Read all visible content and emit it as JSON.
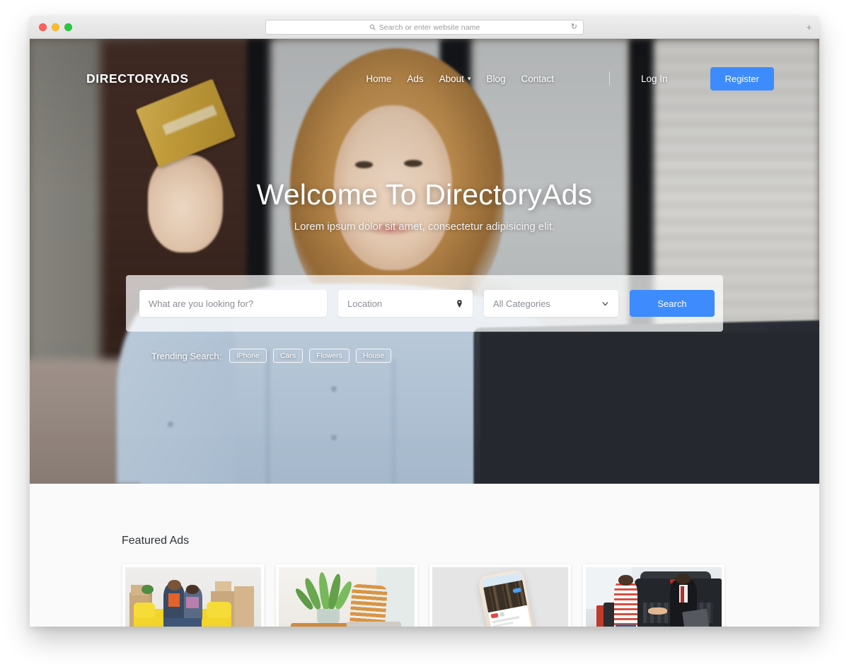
{
  "browser": {
    "omnibox_placeholder": "Search or enter website name",
    "reload_glyph": "↻",
    "newtab_glyph": "+",
    "traffic_lights": [
      "close",
      "minimize",
      "maximize"
    ]
  },
  "header": {
    "brand": "DIRECTORYADS",
    "nav": [
      {
        "label": "Home",
        "has_caret": false
      },
      {
        "label": "Ads",
        "has_caret": false
      },
      {
        "label": "About",
        "has_caret": true
      },
      {
        "label": "Blog",
        "has_caret": false
      },
      {
        "label": "Contact",
        "has_caret": false
      }
    ],
    "login_label": "Log In",
    "register_label": "Register",
    "accent_color": "#3d8bfd"
  },
  "hero": {
    "title": "Welcome To DirectoryAds",
    "subtitle": "Lorem ipsum dolor sit amet, consectetur adipisicing elit."
  },
  "search": {
    "keyword_placeholder": "What are you looking for?",
    "location_placeholder": "Location",
    "category_selected": "All Categories",
    "button_label": "Search"
  },
  "trending": {
    "label": "Trending Search:",
    "tags": [
      "iPhone",
      "Cars",
      "Flowers",
      "House"
    ]
  },
  "featured": {
    "title": "Featured Ads",
    "cards": [
      {
        "alt": "couple sitting on yellow sofa with moving boxes"
      },
      {
        "alt": "wooden patio chair and table with potted plant"
      },
      {
        "alt": "white iphone displaying an app on gray background"
      },
      {
        "alt": "two businessmen shaking hands beside a car"
      }
    ]
  }
}
